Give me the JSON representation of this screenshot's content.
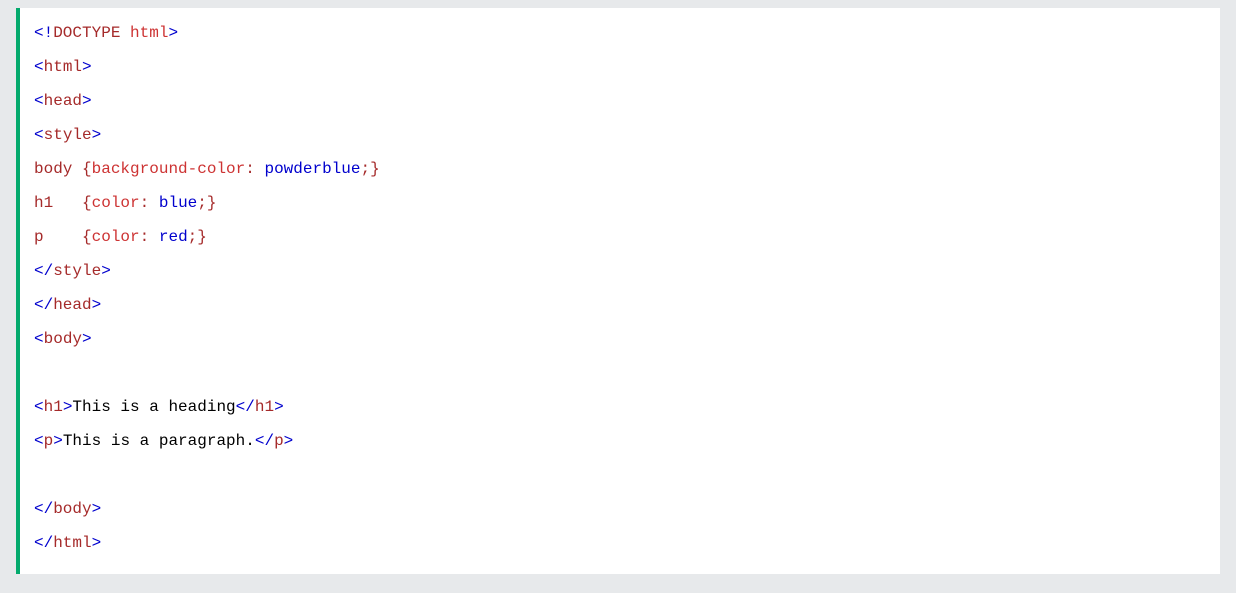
{
  "code": {
    "doctype_open": "<!",
    "doctype_name": "DOCTYPE",
    "doctype_kw": "html",
    "doctype_close": ">",
    "lt": "<",
    "lts": "</",
    "gt": ">",
    "tag_html": "html",
    "tag_head": "head",
    "tag_style": "style",
    "tag_body": "body",
    "tag_h1": "h1",
    "tag_p": "p",
    "css_sel_body": "body ",
    "css_sel_h1": "h1   ",
    "css_sel_p": "p    ",
    "brace_open": "{",
    "brace_close": "}",
    "prop_bg": "background-color",
    "prop_color": "color",
    "colon": ":",
    "semicolon": ";",
    "sp": " ",
    "val_powderblue": "powderblue",
    "val_blue": "blue",
    "val_red": "red",
    "h1_text": "This is a heading",
    "p_text": "This is a paragraph."
  }
}
